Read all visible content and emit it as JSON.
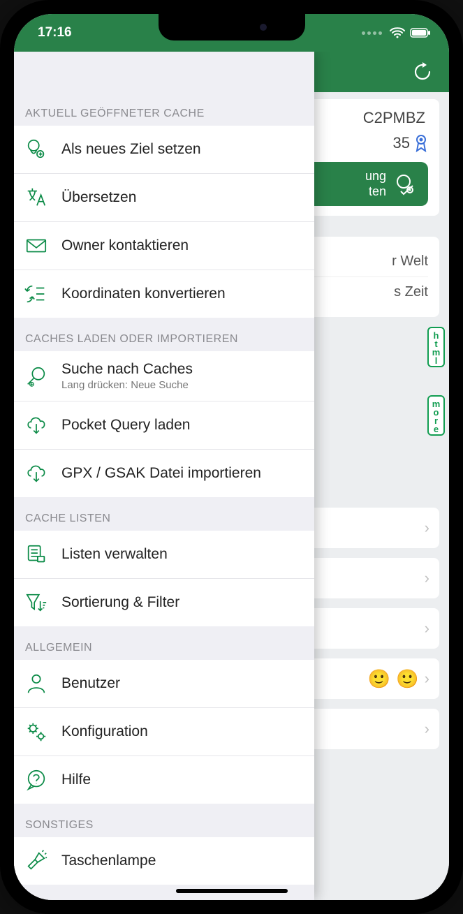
{
  "status": {
    "time": "17:16"
  },
  "background": {
    "gc_code": "C2PMBZ",
    "fav_count": "35",
    "button_line1": "ung",
    "button_line2": "ten",
    "line1": "r Welt",
    "line2": "s Zeit",
    "html_badge": "html",
    "more_badge": "more"
  },
  "menu": {
    "sections": [
      {
        "title": "AKTUELL GEÖFFNETER CACHE",
        "items": [
          {
            "id": "set-target",
            "label": "Als neues Ziel setzen",
            "icon": "target-pin"
          },
          {
            "id": "translate",
            "label": "Übersetzen",
            "icon": "translate"
          },
          {
            "id": "contact-owner",
            "label": "Owner kontaktieren",
            "icon": "mail"
          },
          {
            "id": "convert-coords",
            "label": "Koordinaten konvertieren",
            "icon": "convert"
          }
        ]
      },
      {
        "title": "CACHES LADEN ODER IMPORTIEREN",
        "items": [
          {
            "id": "search-caches",
            "label": "Suche nach Caches",
            "sub": "Lang drücken: Neue Suche",
            "icon": "search"
          },
          {
            "id": "pocket-query",
            "label": "Pocket Query laden",
            "icon": "cloud-down"
          },
          {
            "id": "gpx-import",
            "label": "GPX / GSAK Datei importieren",
            "icon": "cloud-down"
          }
        ]
      },
      {
        "title": "CACHE LISTEN",
        "items": [
          {
            "id": "manage-lists",
            "label": "Listen verwalten",
            "icon": "list-manage"
          },
          {
            "id": "sort-filter",
            "label": "Sortierung & Filter",
            "icon": "funnel"
          }
        ]
      },
      {
        "title": "ALLGEMEIN",
        "items": [
          {
            "id": "user",
            "label": "Benutzer",
            "icon": "user"
          },
          {
            "id": "config",
            "label": "Konfiguration",
            "icon": "gears"
          },
          {
            "id": "help",
            "label": "Hilfe",
            "icon": "help"
          }
        ]
      },
      {
        "title": "SONSTIGES",
        "items": [
          {
            "id": "flashlight",
            "label": "Taschenlampe",
            "icon": "flashlight"
          }
        ]
      }
    ]
  }
}
